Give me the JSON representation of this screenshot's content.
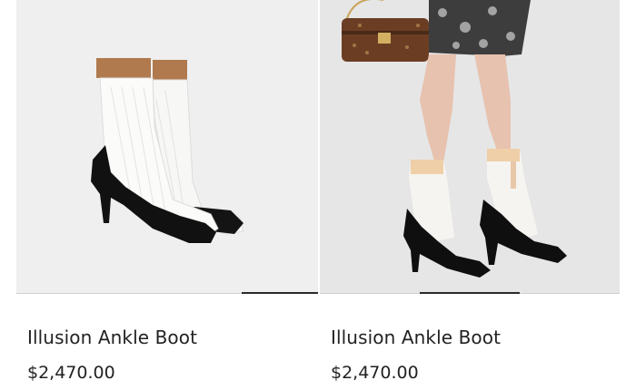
{
  "products": [
    {
      "name": "Illusion Ankle Boot",
      "price": "$2,470.00",
      "image": "boot-product-photo",
      "carousel_position": 0.5
    },
    {
      "name": "Illusion Ankle Boot",
      "price": "$2,470.00",
      "image": "boot-model-photo",
      "carousel_position": 0.5
    }
  ]
}
